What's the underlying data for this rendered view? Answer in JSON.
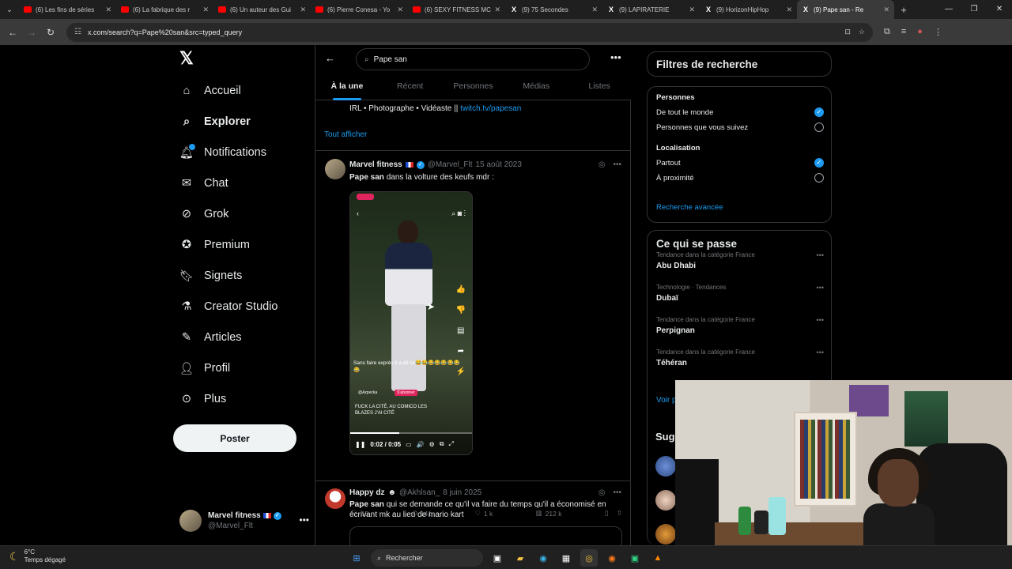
{
  "browser": {
    "tabs": [
      {
        "title": "(6) Les fins de séries",
        "icon": "youtube-icon"
      },
      {
        "title": "(6) La fabrique des r",
        "icon": "youtube-icon"
      },
      {
        "title": "(6) Un auteur des Gui",
        "icon": "youtube-icon"
      },
      {
        "title": "(6) Pierre Conesa - Yo",
        "icon": "youtube-icon"
      },
      {
        "title": "(6) SEXY FITNESS MC",
        "icon": "youtube-icon"
      },
      {
        "title": "(9) 75 Secondes",
        "icon": "x-icon"
      },
      {
        "title": "(9) LAPIRATERIE",
        "icon": "x-icon"
      },
      {
        "title": "(9) HorizonHipHop",
        "icon": "x-icon"
      },
      {
        "title": "(9) Pape san - Re",
        "icon": "x-icon",
        "active": true
      }
    ],
    "url": "x.com/search?q=Pape%20san&src=typed_query"
  },
  "nav": {
    "items": [
      {
        "label": "Accueil",
        "icon": "home-icon"
      },
      {
        "label": "Explorer",
        "icon": "search-icon",
        "bold": true
      },
      {
        "label": "Notifications",
        "icon": "bell-icon"
      },
      {
        "label": "Chat",
        "icon": "mail-icon"
      },
      {
        "label": "Grok",
        "icon": "grok-icon"
      },
      {
        "label": "Premium",
        "icon": "premium-icon"
      },
      {
        "label": "Signets",
        "icon": "bookmark-icon"
      },
      {
        "label": "Creator Studio",
        "icon": "creator-icon"
      },
      {
        "label": "Articles",
        "icon": "articles-icon"
      },
      {
        "label": "Profil",
        "icon": "profile-icon"
      },
      {
        "label": "Plus",
        "icon": "more-icon"
      }
    ],
    "post_label": "Poster",
    "account": {
      "name": "Marvel fitness",
      "handle": "@Marvel_Flt"
    }
  },
  "search": {
    "query": "Pape san",
    "tabs": [
      "À la une",
      "Récent",
      "Personnes",
      "Médias",
      "Listes"
    ],
    "active_tab": "À la une"
  },
  "results": {
    "bio_text": "IRL • Photographe • Vidéaste ||",
    "bio_link": "twitch.tv/papesan",
    "show_all": "Tout afficher",
    "tweets": [
      {
        "name": "Marvel fitness",
        "handle": "@Marvel_Flt",
        "date": "15 août 2023",
        "text_bold": "Pape san",
        "text_rest": " dans la volture des keufs mdr :",
        "video": {
          "caption": "Sans faire exprès il a dit sa😂😂😂😂😂😂😂😂",
          "caption2": "FUCK LA CITÉ, AU COMICO LES BLAZES J'AI CITÉ",
          "handle": "@Azpecka",
          "subscribe": "S'abonner",
          "time": "0:02 / 0:05",
          "progress": 0.4
        },
        "stats": {
          "replies": "15",
          "reposts": "141",
          "likes": "1 k",
          "views": "212 k"
        }
      },
      {
        "name": "Happy dz",
        "handle": "@Akhlsan_",
        "date": "8 juin 2025",
        "text_bold": "Pape san",
        "text_rest": " qui se demande ce qu'il va faire du temps qu'il a économisé en écrivant mk au lieu de mario kart"
      }
    ]
  },
  "filters": {
    "title": "Filtres de recherche",
    "people_label": "Personnes",
    "people_options": [
      {
        "label": "De tout le monde",
        "selected": true
      },
      {
        "label": "Personnes que vous suivez",
        "selected": false
      }
    ],
    "location_label": "Localisation",
    "location_options": [
      {
        "label": "Partout",
        "selected": true
      },
      {
        "label": "À proximité",
        "selected": false
      }
    ],
    "advanced": "Recherche avancée"
  },
  "trends": {
    "title": "Ce qui se passe",
    "items": [
      {
        "category": "Tendance dans la catégorie France",
        "name": "Abu Dhabi"
      },
      {
        "category": "Technologie · Tendances",
        "name": "Dubaï"
      },
      {
        "category": "Tendance dans la catégorie France",
        "name": "Perpignan"
      },
      {
        "category": "Tendance dans la catégorie France",
        "name": "Téhéran"
      }
    ],
    "see_more": "Voir p",
    "suggestions_title": "Sug"
  },
  "taskbar": {
    "temp": "6°C",
    "weather": "Temps dégagé",
    "search_label": "Rechercher"
  },
  "colors": {
    "accent": "#1d9bf0",
    "background": "#000000",
    "border": "#2f3336",
    "muted": "#71767b"
  }
}
